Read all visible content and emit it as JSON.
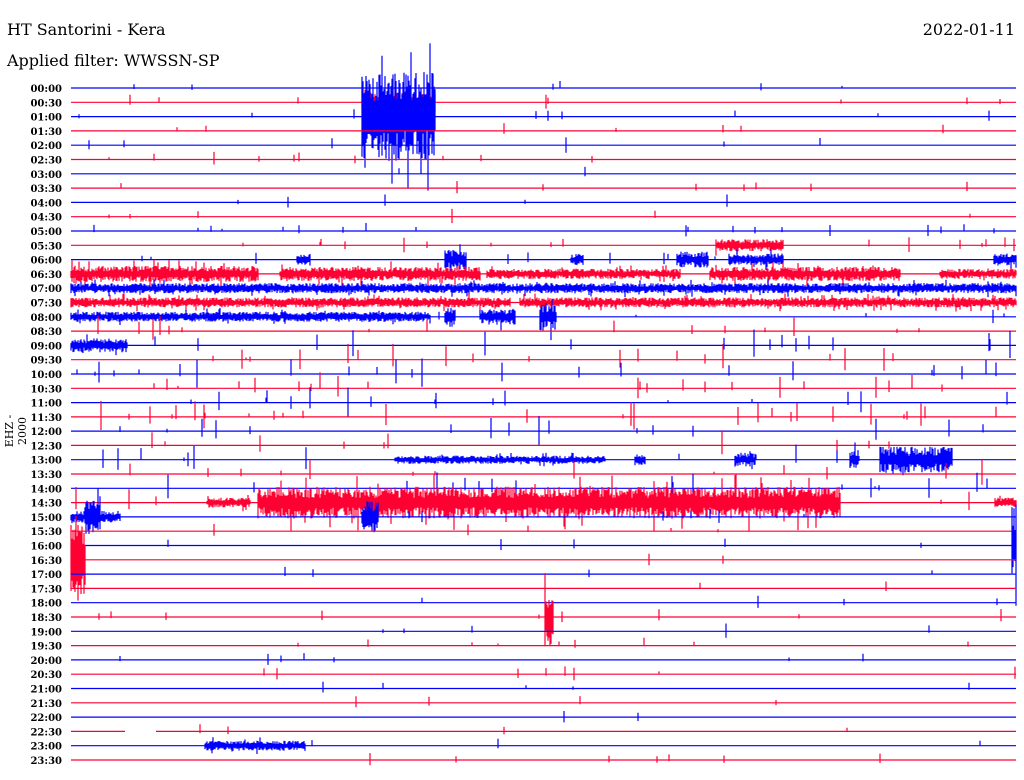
{
  "header": {
    "title": "HT Santorini - Kera",
    "filter": "Applied filter: WWSSN-SP",
    "date": "2022-01-11"
  },
  "chart_data": {
    "type": "line",
    "title": "HT Santorini - Kera",
    "subtitle": "Applied filter: WWSSN-SP",
    "ylabel": "EHZ - 2000",
    "row_labels": [
      "00:00",
      "00:30",
      "01:00",
      "01:30",
      "02:00",
      "02:30",
      "03:00",
      "03:30",
      "04:00",
      "04:30",
      "05:00",
      "05:30",
      "06:00",
      "06:30",
      "07:00",
      "07:30",
      "08:00",
      "08:30",
      "09:00",
      "09:30",
      "10:00",
      "10:30",
      "11:00",
      "11:30",
      "12:00",
      "12:30",
      "13:00",
      "13:30",
      "14:00",
      "14:30",
      "15:00",
      "15:30",
      "16:00",
      "16:30",
      "17:00",
      "17:30",
      "18:00",
      "18:30",
      "19:00",
      "19:30",
      "20:00",
      "20:30",
      "21:00",
      "21:30",
      "22:00",
      "22:30",
      "23:00",
      "23:30"
    ],
    "series_colors": [
      "#0000ff",
      "#ff0033"
    ],
    "minutes_per_row": 30
  }
}
